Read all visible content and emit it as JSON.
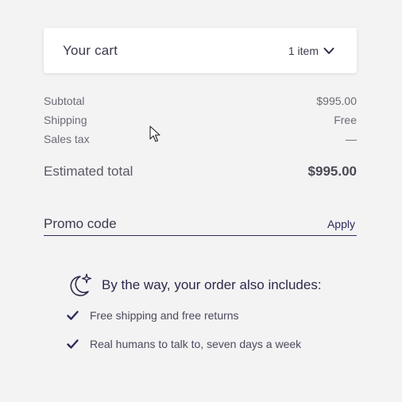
{
  "cart": {
    "title": "Your cart",
    "count_label": "1 item"
  },
  "summary": {
    "rows": [
      {
        "label": "Subtotal",
        "value": "$995.00"
      },
      {
        "label": "Shipping",
        "value": "Free"
      },
      {
        "label": "Sales tax",
        "value": "—"
      }
    ],
    "total_label": "Estimated total",
    "total_value": "$995.00"
  },
  "promo": {
    "placeholder": "Promo code",
    "apply_label": "Apply"
  },
  "includes": {
    "heading": "By the way, your order also includes:",
    "items": [
      "Free shipping and free returns",
      "Real humans to talk to, seven days a week"
    ]
  },
  "colors": {
    "accent": "#2d2a5a",
    "background": "#f3f3f4"
  }
}
